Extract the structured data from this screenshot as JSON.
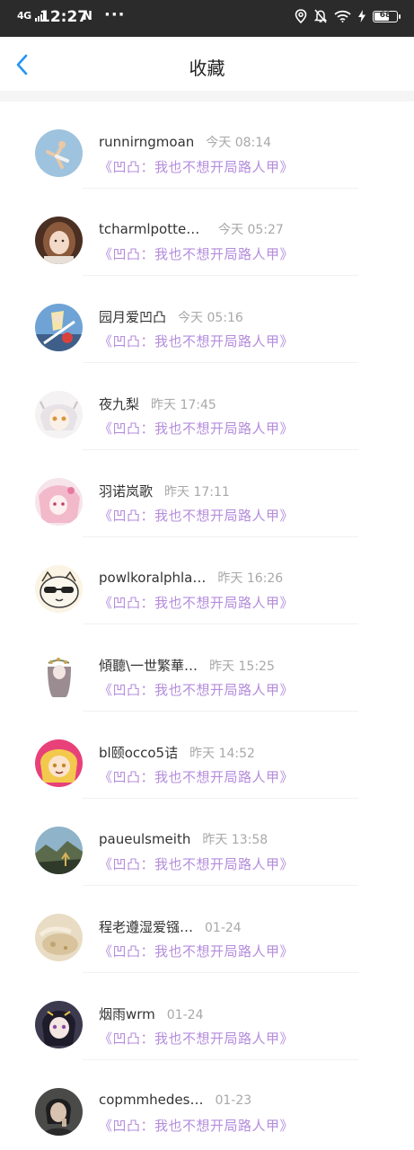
{
  "status_bar": {
    "network": "4G",
    "time": "12:27",
    "app_icon": "N",
    "more": "···",
    "icons": [
      "location-icon",
      "notification-off-icon",
      "wifi-icon",
      "charging-icon"
    ],
    "battery": 68
  },
  "header": {
    "title": "收藏",
    "accent": "#2196f3"
  },
  "colors": {
    "book_link": "#b48cdc",
    "time_text": "#a8a8a8",
    "name_text": "#333333"
  },
  "items": [
    {
      "name": "runnirngmoan",
      "time": "今天 08:14",
      "book": "《凹凸：我也不想开局路人甲》",
      "avatar": "yoga-pose-avatar"
    },
    {
      "name": "tcharmlpotteo…",
      "time": "今天 05:27",
      "book": "《凹凸：我也不想开局路人甲》",
      "avatar": "girl-portrait-avatar"
    },
    {
      "name": "园月爱凹凸",
      "time": "今天 05:16",
      "book": "《凹凸：我也不想开局路人甲》",
      "avatar": "anime-art-avatar"
    },
    {
      "name": "夜九梨",
      "time": "昨天 17:45",
      "book": "《凹凸：我也不想开局路人甲》",
      "avatar": "white-hair-anime-avatar"
    },
    {
      "name": "羽诺岚歌",
      "time": "昨天 17:11",
      "book": "《凹凸：我也不想开局路人甲》",
      "avatar": "pink-anime-avatar"
    },
    {
      "name": "powlkoralphla…",
      "time": "昨天 16:26",
      "book": "《凹凸：我也不想开局路人甲》",
      "avatar": "cool-cat-avatar"
    },
    {
      "name": "傾聽\\一世繁華…",
      "time": "昨天 15:25",
      "book": "《凹凸：我也不想开局路人甲》",
      "avatar": "flower-girl-avatar"
    },
    {
      "name": "bl颐occo5诘",
      "time": "昨天 14:52",
      "book": "《凹凸：我也不想开局路人甲》",
      "avatar": "blonde-anime-avatar"
    },
    {
      "name": "paueulsmeith",
      "time": "昨天 13:58",
      "book": "《凹凸：我也不想开局路人甲》",
      "avatar": "landscape-avatar"
    },
    {
      "name": "程老遵湿爱镪…",
      "time": "01-24",
      "book": "《凹凸：我也不想开局路人甲》",
      "avatar": "sand-photo-avatar"
    },
    {
      "name": "烟雨wrm",
      "time": "01-24",
      "book": "《凹凸：我也不想开局路人甲》",
      "avatar": "dark-anime-avatar"
    },
    {
      "name": "copmmhedes…",
      "time": "01-23",
      "book": "《凹凸：我也不想开局路人甲》",
      "avatar": "portrait-photo-avatar"
    }
  ]
}
